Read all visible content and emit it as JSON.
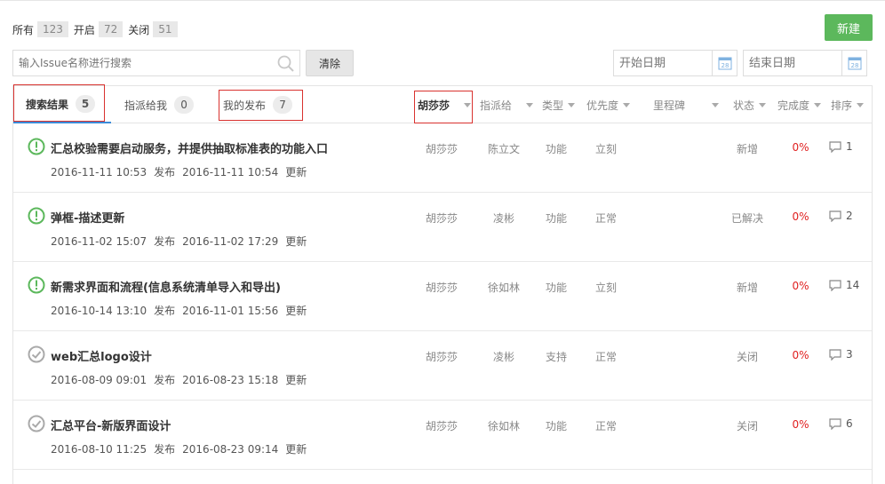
{
  "counts": {
    "all_label": "所有",
    "all": "123",
    "open_label": "开启",
    "open": "72",
    "closed_label": "关闭",
    "closed": "51"
  },
  "new_button": "新建",
  "search": {
    "placeholder": "输入Issue名称进行搜索"
  },
  "clear_button": "清除",
  "date": {
    "start_placeholder": "开始日期",
    "end_placeholder": "结束日期",
    "calendar_icon_text": "28"
  },
  "tabs": [
    {
      "label": "搜索结果",
      "count": "5"
    },
    {
      "label": "指派给我",
      "count": "0"
    },
    {
      "label": "我的发布",
      "count": "7"
    }
  ],
  "filters": {
    "author": "胡莎莎",
    "assignee": "指派给",
    "type": "类型",
    "priority": "优先度",
    "milestone": "里程碑",
    "status": "状态",
    "completion": "完成度",
    "sort": "排序"
  },
  "colors": {
    "open_icon": "#5cb85c",
    "closed_icon": "#aaaaaa",
    "progress": "#e02020",
    "accent": "#3b8bd9",
    "highlight_box": "#d9322f"
  },
  "issues": [
    {
      "state_icon": "open-exclamation-icon",
      "title": "汇总校验需要启动服务，并提供抽取标准表的功能入口",
      "created": "2016-11-11 10:53",
      "created_label": "发布",
      "updated": "2016-11-11 10:54",
      "updated_label": "更新",
      "author": "胡莎莎",
      "assignee": "陈立文",
      "type": "功能",
      "priority": "立刻",
      "status": "新增",
      "progress": "0%",
      "comments": "1"
    },
    {
      "state_icon": "open-exclamation-icon",
      "title": "弹框-描述更新",
      "created": "2016-11-02 15:07",
      "created_label": "发布",
      "updated": "2016-11-02 17:29",
      "updated_label": "更新",
      "author": "胡莎莎",
      "assignee": "凌彬",
      "type": "功能",
      "priority": "正常",
      "status": "已解决",
      "progress": "0%",
      "comments": "2"
    },
    {
      "state_icon": "open-exclamation-icon",
      "title": "新需求界面和流程(信息系统清单导入和导出)",
      "created": "2016-10-14 13:10",
      "created_label": "发布",
      "updated": "2016-11-01 15:56",
      "updated_label": "更新",
      "author": "胡莎莎",
      "assignee": "徐如林",
      "type": "功能",
      "priority": "立刻",
      "status": "新增",
      "progress": "0%",
      "comments": "14"
    },
    {
      "state_icon": "closed-check-icon",
      "title": "web汇总logo设计",
      "created": "2016-08-09 09:01",
      "created_label": "发布",
      "updated": "2016-08-23 15:18",
      "updated_label": "更新",
      "author": "胡莎莎",
      "assignee": "凌彬",
      "type": "支持",
      "priority": "正常",
      "status": "关闭",
      "progress": "0%",
      "comments": "3"
    },
    {
      "state_icon": "closed-check-icon",
      "title": "汇总平台-新版界面设计",
      "created": "2016-08-10 11:25",
      "created_label": "发布",
      "updated": "2016-08-23 09:14",
      "updated_label": "更新",
      "author": "胡莎莎",
      "assignee": "徐如林",
      "type": "功能",
      "priority": "正常",
      "status": "关闭",
      "progress": "0%",
      "comments": "6"
    }
  ]
}
